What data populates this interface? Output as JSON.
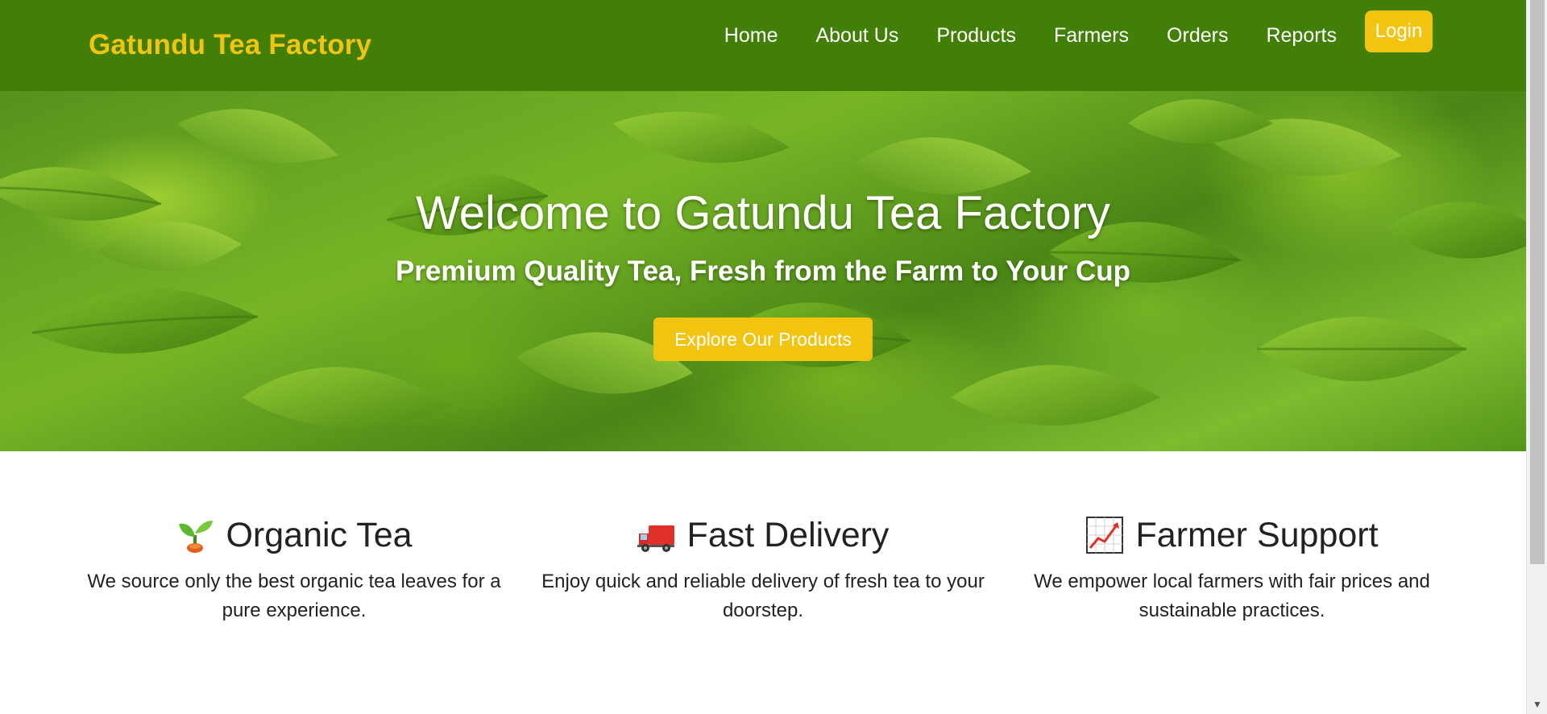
{
  "brand": {
    "name": "Gatundu Tea Factory"
  },
  "nav": {
    "links": [
      "Home",
      "About Us",
      "Products",
      "Farmers",
      "Orders",
      "Reports"
    ],
    "login_label": "Login"
  },
  "hero": {
    "title": "Welcome to Gatundu Tea Factory",
    "subtitle": "Premium Quality Tea, Fresh from the Farm to Your Cup",
    "cta_label": "Explore Our Products"
  },
  "features": [
    {
      "icon": "seedling-icon",
      "title": "Organic Tea",
      "text": "We source only the best organic tea leaves for a pure experience."
    },
    {
      "icon": "delivery-truck-icon",
      "title": "Fast Delivery",
      "text": "Enjoy quick and reliable delivery of fresh tea to your doorstep."
    },
    {
      "icon": "chart-increasing-icon",
      "title": "Farmer Support",
      "text": "We empower local farmers with fair prices and sustainable practices."
    }
  ],
  "colors": {
    "navbar_bg": "#417f06",
    "accent": "#f2c30f",
    "text": "#222222"
  }
}
